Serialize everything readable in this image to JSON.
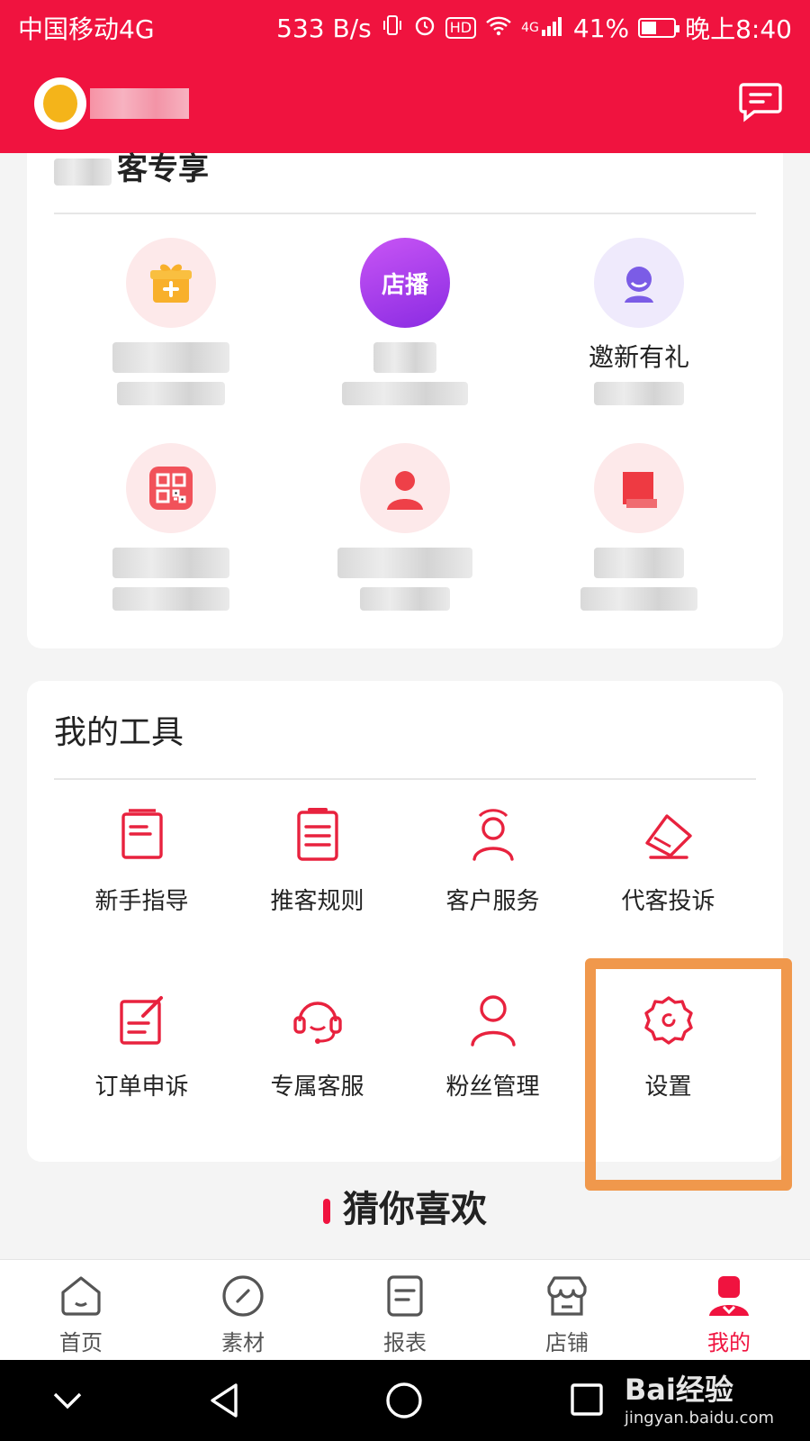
{
  "status_bar": {
    "carrier": "中国移动4G",
    "net_speed": "533 B/s",
    "hd": "HD",
    "signal_type": "4G",
    "battery": "41%",
    "time": "晚上8:40"
  },
  "header": {
    "message_icon": "message-icon"
  },
  "exclusive": {
    "title_suffix": "客专享",
    "items": [
      {
        "label": "",
        "icon": "gift-icon"
      },
      {
        "label": "",
        "icon": "live-icon",
        "badge": "店播"
      },
      {
        "label": "邀新有礼",
        "icon": "invite-icon"
      },
      {
        "label": "",
        "icon": "qr-code-icon"
      },
      {
        "label": "",
        "icon": "person-icon"
      },
      {
        "label": "",
        "icon": "book-icon"
      }
    ]
  },
  "tools": {
    "title": "我的工具",
    "items": [
      {
        "label": "新手指导",
        "icon": "guide-icon"
      },
      {
        "label": "推客规则",
        "icon": "rules-icon"
      },
      {
        "label": "客户服务",
        "icon": "customer-service-icon"
      },
      {
        "label": "代客投诉",
        "icon": "complaint-icon"
      },
      {
        "label": "订单申诉",
        "icon": "order-appeal-icon"
      },
      {
        "label": "专属客服",
        "icon": "headset-icon"
      },
      {
        "label": "粉丝管理",
        "icon": "fans-icon"
      },
      {
        "label": "设置",
        "icon": "settings-icon"
      }
    ]
  },
  "recommend": {
    "title": "猜你喜欢"
  },
  "tab_bar": {
    "items": [
      {
        "label": "首页",
        "icon": "home-icon"
      },
      {
        "label": "素材",
        "icon": "material-icon"
      },
      {
        "label": "报表",
        "icon": "report-icon"
      },
      {
        "label": "店铺",
        "icon": "store-icon"
      },
      {
        "label": "我的",
        "icon": "profile-icon"
      }
    ],
    "active": "我的"
  },
  "watermark": {
    "brand": "Bai经验",
    "url": "jingyan.baidu.com"
  },
  "colors": {
    "brand_red": "#f0133f",
    "highlight_orange": "#f0984c"
  }
}
